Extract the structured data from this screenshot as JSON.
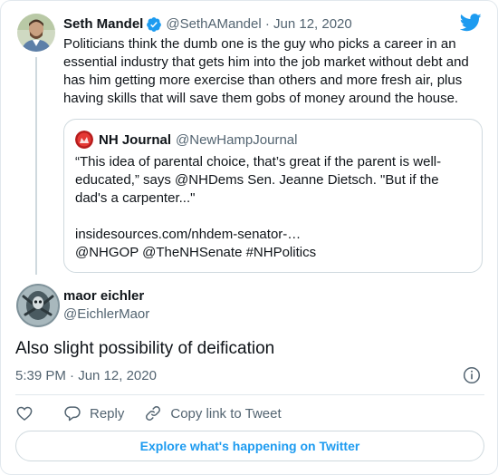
{
  "parent_tweet": {
    "author_name": "Seth Mandel",
    "author_handle": "@SethAMandel",
    "separator": "·",
    "date": "Jun 12, 2020",
    "text": "Politicians think the dumb one is the guy who picks a career in an essential industry that gets him into the job market without debt and has him getting more exercise than others and more fresh air, plus having skills that will save them gobs of money around the house."
  },
  "quote_tweet": {
    "author_name": "NH Journal",
    "author_handle": "@NewHampJournal",
    "text": "“This idea of parental choice, that’s great if the parent is well-educated,” says @NHDems Sen. Jeanne Dietsch. \"But if the dad's a carpenter...\"",
    "link": "insidesources.com/nhdem-senator-…",
    "hashtags_line": "@NHGOP @TheNHSenate #NHPolitics"
  },
  "reply_tweet": {
    "author_name": "maor eichler",
    "author_handle": "@EichlerMaor",
    "text": "Also slight possibility of deification",
    "time": "5:39 PM",
    "separator": "·",
    "date": "Jun 12, 2020"
  },
  "actions": {
    "reply_label": "Reply",
    "copy_link_label": "Copy link to Tweet"
  },
  "explore_label": "Explore what's happening on Twitter",
  "icons": {
    "twitter_bird": "twitter-bird-icon",
    "verified": "verified-badge-icon",
    "info": "info-icon",
    "like": "heart-icon",
    "reply": "reply-bubble-icon",
    "copy_link": "link-icon"
  },
  "colors": {
    "twitter_blue": "#1d9bf0",
    "like_red": "#e0245e",
    "secondary_text": "#536471"
  }
}
